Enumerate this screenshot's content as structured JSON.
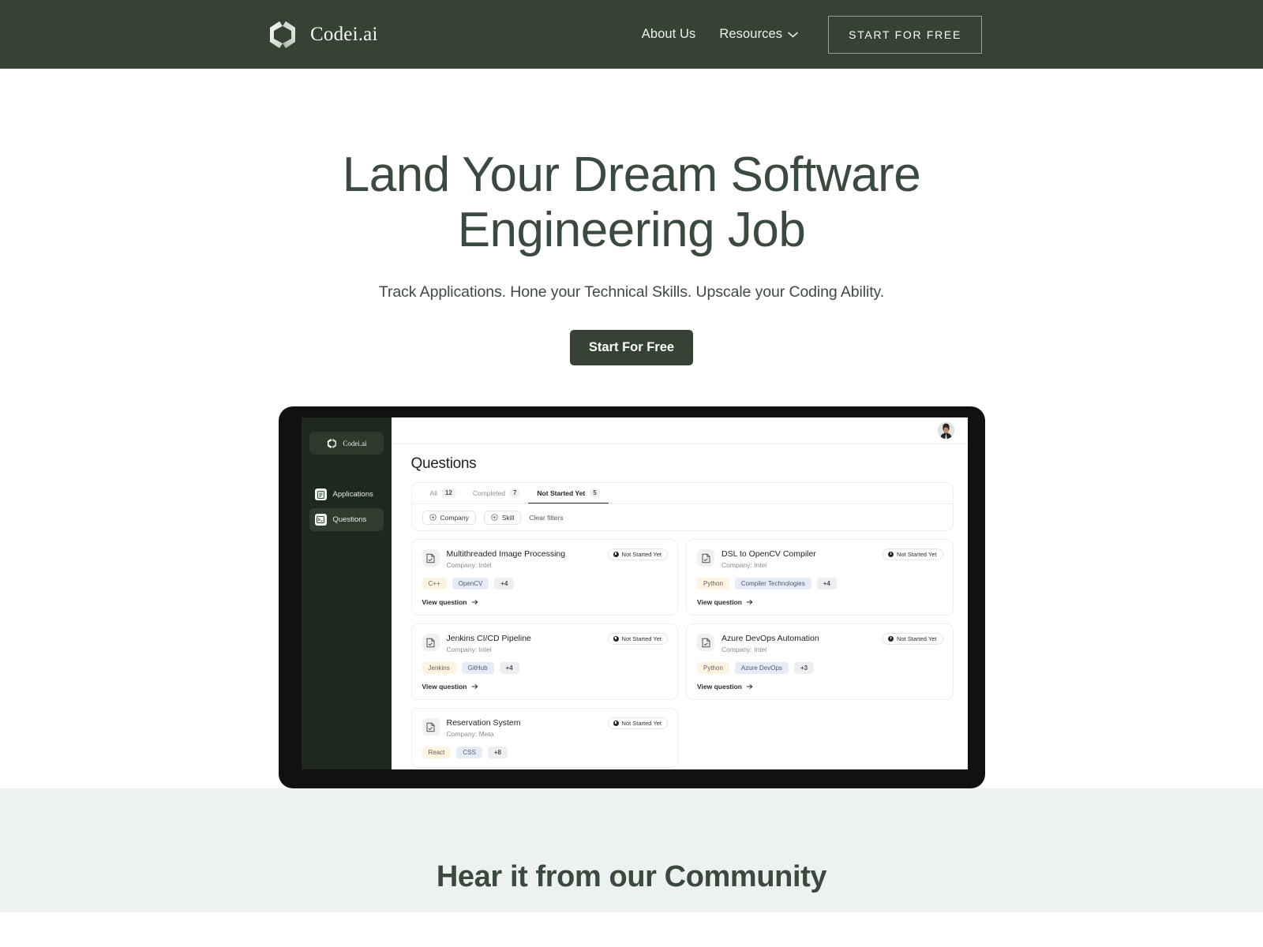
{
  "nav": {
    "brand_name": "Codei.ai",
    "logo_icon": "codei-logo-icon",
    "links": [
      {
        "label": "About Us"
      },
      {
        "label": "Resources",
        "icon": "chevron-down-icon"
      }
    ],
    "cta_label": "START FOR FREE",
    "background_color": "#374237"
  },
  "hero": {
    "headline_line1": "Land Your Dream Software",
    "headline_line2": "Engineering Job",
    "subheadline": "Track Applications. Hone your Technical Skills. Upscale your Coding Ability.",
    "cta_label": "Start For Free",
    "text_color": "#3b4a3f",
    "cta_background": "#374237"
  },
  "app_preview": {
    "sidebar": {
      "brand_name": "Codei.ai",
      "logo_icon": "codei-logo-icon",
      "items": [
        {
          "label": "Applications",
          "icon": "document-list-icon",
          "active": false
        },
        {
          "label": "Questions",
          "icon": "terminal-icon",
          "active": true
        }
      ],
      "background_color": "#1e2820"
    },
    "topbar": {
      "avatar_icon": "user-avatar"
    },
    "page_title": "Questions",
    "tabs": [
      {
        "label": "All",
        "count": "12",
        "active": false
      },
      {
        "label": "Completed",
        "count": "7",
        "active": false
      },
      {
        "label": "Not Started Yet",
        "count": "5",
        "active": true
      }
    ],
    "filters": {
      "chips": [
        {
          "label": "Company",
          "icon": "plus-circle-icon"
        },
        {
          "label": "Skill",
          "icon": "plus-circle-icon"
        }
      ],
      "clear_label": "Clear filters"
    },
    "view_question_label": "View question",
    "status_badge_label": "Not Started Yet",
    "cards": [
      {
        "title": "Multithreaded Image Processing",
        "company": "Company: Intel",
        "status": "Not Started Yet",
        "tags": [
          "C++",
          "OpenCV",
          "+4"
        ],
        "link": "View question"
      },
      {
        "title": "DSL to OpenCV Compiler",
        "company": "Company: Intel",
        "status": "Not Started Yet",
        "tags": [
          "Python",
          "Compiler Technologies",
          "+4"
        ],
        "link": "View question"
      },
      {
        "title": "Jenkins CI/CD Pipeline",
        "company": "Company: Intel",
        "status": "Not Started Yet",
        "tags": [
          "Jenkins",
          "GitHub",
          "+4"
        ],
        "link": "View question"
      },
      {
        "title": "Azure DevOps Automation",
        "company": "Company: Intel",
        "status": "Not Started Yet",
        "tags": [
          "Python",
          "Azure DevOps",
          "+3"
        ],
        "link": "View question"
      },
      {
        "title": "Reservation System",
        "company": "Company: Meta",
        "status": "Not Started Yet",
        "tags": [
          "React",
          "CSS",
          "+8"
        ],
        "link": "View question"
      }
    ]
  },
  "community": {
    "heading": "Hear it from our Community",
    "background_color": "#edf1f0"
  }
}
